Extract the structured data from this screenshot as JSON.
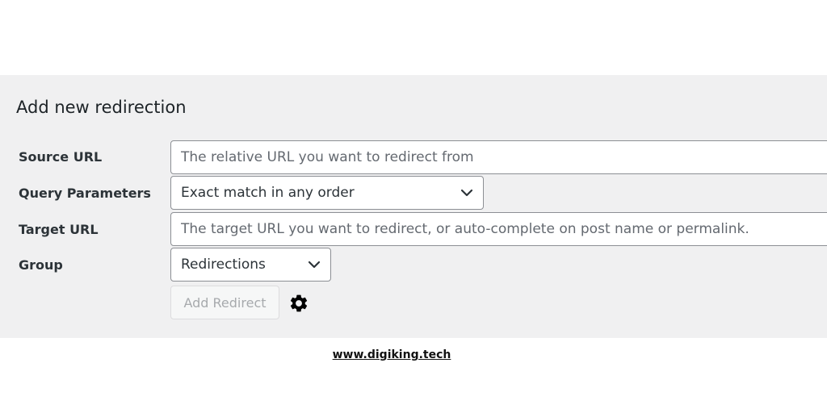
{
  "panel": {
    "title": "Add new redirection"
  },
  "fields": {
    "source_url": {
      "label": "Source URL",
      "placeholder": "The relative URL you want to redirect from",
      "value": ""
    },
    "query_parameters": {
      "label": "Query Parameters",
      "selected": "Exact match in any order"
    },
    "target_url": {
      "label": "Target URL",
      "placeholder": "The target URL you want to redirect, or auto-complete on post name or permalink.",
      "value": ""
    },
    "group": {
      "label": "Group",
      "selected": "Redirections"
    }
  },
  "actions": {
    "add_label": "Add Redirect",
    "add_disabled": true,
    "options_icon": "gear-icon"
  },
  "footer": {
    "link_text": "www.digiking.tech"
  },
  "colors": {
    "panel_background": "#f0f0f1",
    "border": "#8c8f94",
    "text": "#2c3338",
    "disabled_text": "#a7aaad"
  }
}
